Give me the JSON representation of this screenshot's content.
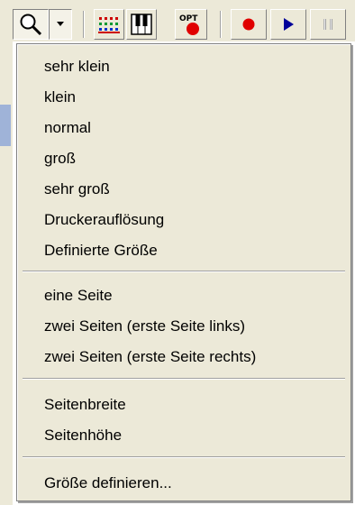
{
  "toolbar": {
    "buttons": [
      {
        "icon": "magnifier-icon"
      },
      {
        "icon": "dropdown-arrow-icon"
      },
      {
        "icon": "piano-roll-icon"
      },
      {
        "icon": "keyboard-icon"
      },
      {
        "icon": "options-record-icon",
        "text": "OPT"
      },
      {
        "icon": "record-icon"
      },
      {
        "icon": "play-icon"
      },
      {
        "icon": "pause-icon"
      }
    ],
    "colors": {
      "record": "#e00000",
      "play": "#000099",
      "pause_disabled": "#a0a0a0"
    }
  },
  "menu": {
    "group1": [
      "sehr klein",
      "klein",
      "normal",
      "groß",
      "sehr groß",
      "Druckerauflösung",
      "Definierte Größe"
    ],
    "group2": [
      "eine Seite",
      "zwei Seiten (erste Seite links)",
      "zwei Seiten (erste Seite rechts)"
    ],
    "group3": [
      "Seitenbreite",
      "Seitenhöhe"
    ],
    "group4": [
      "Größe definieren..."
    ]
  }
}
